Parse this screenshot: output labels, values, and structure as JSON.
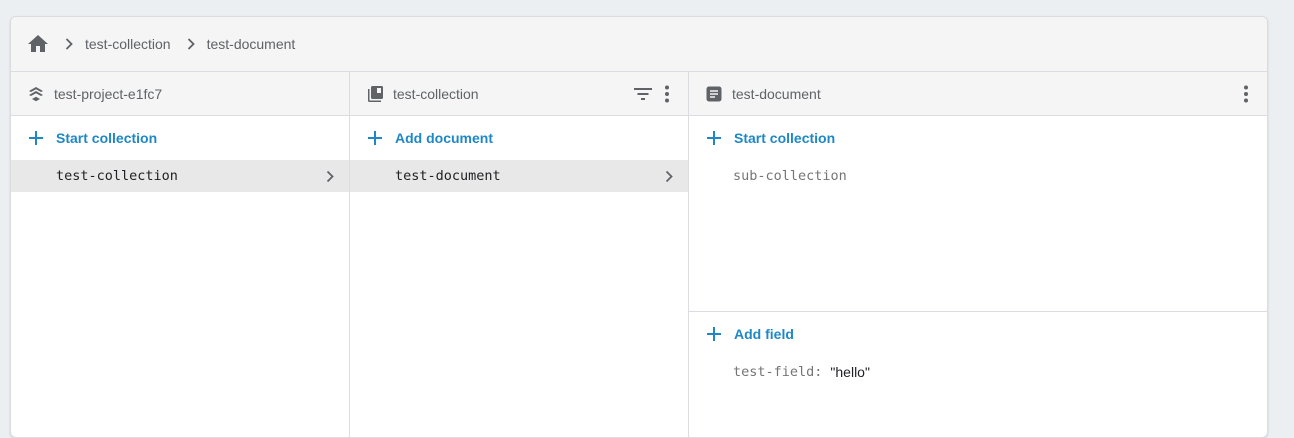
{
  "breadcrumb": {
    "home_icon": "home-icon",
    "items": [
      "test-collection",
      "test-document"
    ]
  },
  "panels": {
    "project": {
      "title": "test-project-e1fc7",
      "icon": "firebase-project-icon",
      "add_label": "Start collection",
      "items": [
        {
          "label": "test-collection",
          "selected": true
        }
      ]
    },
    "collection": {
      "title": "test-collection",
      "icon": "collection-icon",
      "add_label": "Add document",
      "items": [
        {
          "label": "test-document",
          "selected": true
        }
      ]
    },
    "document": {
      "title": "test-document",
      "icon": "document-icon",
      "add_collection_label": "Start collection",
      "subcollections": [
        "sub-collection"
      ],
      "add_field_label": "Add field",
      "fields": [
        {
          "key": "test-field",
          "value": "\"hello\""
        }
      ]
    }
  },
  "colors": {
    "accent": "#1e88c7",
    "icon_gray": "#5f6368",
    "selected_bg": "#e8e8e8",
    "header_bg": "#f5f5f5",
    "page_bg": "#eceff1"
  }
}
